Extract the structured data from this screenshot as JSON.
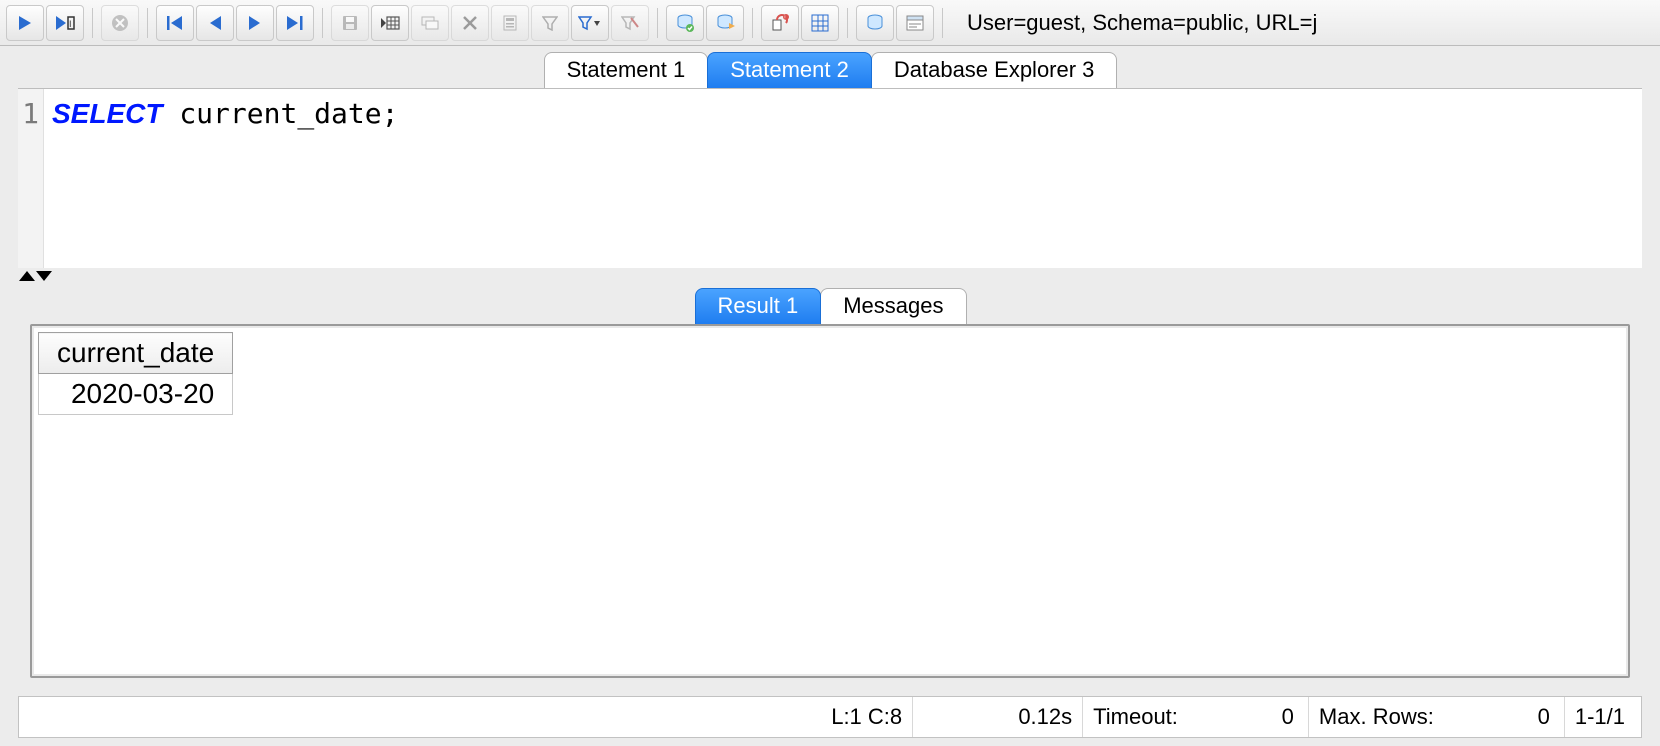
{
  "toolbar": {
    "status_text": "User=guest, Schema=public, URL=j",
    "icons": {
      "run": "run-icon",
      "run_script": "run-script-icon",
      "stop": "stop-icon",
      "first": "first-record-icon",
      "prev": "prev-record-icon",
      "next": "next-record-icon",
      "last": "last-record-icon",
      "save": "save-icon",
      "insert_row": "insert-row-icon",
      "duplicate_row": "duplicate-row-icon",
      "delete_row": "delete-row-icon",
      "edit_cell": "edit-cell-icon",
      "filter": "filter-icon",
      "filter_dropdown": "filter-dropdown-icon",
      "clear_filter": "clear-filter-icon",
      "commit": "commit-icon",
      "rollback": "rollback-icon",
      "reconnect": "reconnect-icon",
      "pivot": "pivot-icon",
      "db_browser": "db-browser-icon",
      "dbms_output": "dbms-output-icon"
    }
  },
  "tabs": {
    "items": [
      {
        "label": "Statement 1",
        "active": false
      },
      {
        "label": "Statement 2",
        "active": true
      },
      {
        "label": "Database Explorer 3",
        "active": false
      }
    ]
  },
  "editor": {
    "line_number": "1",
    "sql_keyword": "SELECT",
    "sql_rest": " current_date;"
  },
  "result_tabs": {
    "items": [
      {
        "label": "Result 1",
        "active": true
      },
      {
        "label": "Messages",
        "active": false
      }
    ]
  },
  "result": {
    "columns": [
      "current_date"
    ],
    "rows": [
      [
        "2020-03-20"
      ]
    ]
  },
  "statusbar": {
    "cursor": "L:1 C:8",
    "elapsed": "0.12s",
    "timeout_label": "Timeout:",
    "timeout_value": "0",
    "maxrows_label": "Max. Rows:",
    "maxrows_value": "0",
    "row_position": "1-1/1"
  }
}
